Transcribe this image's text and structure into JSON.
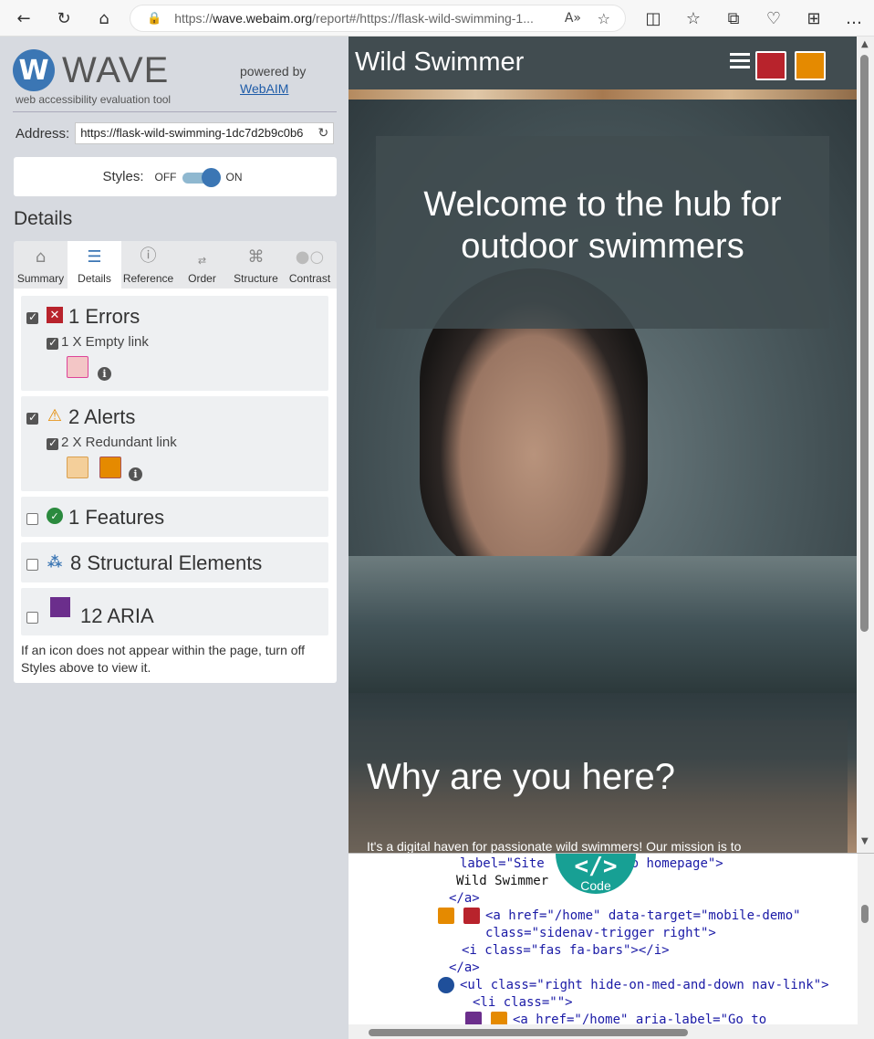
{
  "browser": {
    "url_prefix": "https://",
    "url_host": "wave.webaim.org",
    "url_rest": "/report#/https://flask-wild-swimming-1..."
  },
  "wave": {
    "logo_letter": "W",
    "logo_word": "WAVE",
    "tagline": "web accessibility evaluation tool",
    "powered_by": "powered by",
    "webaim_link": "WebAIM",
    "address_label": "Address:",
    "address_value": "https://flask-wild-swimming-1dc7d2b9c0b6",
    "styles_label": "Styles:",
    "styles_off": "OFF",
    "styles_on": "ON",
    "details_heading": "Details",
    "tabs": [
      {
        "label": "Summary",
        "icon": "home-icon"
      },
      {
        "label": "Details",
        "icon": "list-icon"
      },
      {
        "label": "Reference",
        "icon": "info-icon"
      },
      {
        "label": "Order",
        "icon": "order-icon"
      },
      {
        "label": "Structure",
        "icon": "structure-icon"
      },
      {
        "label": "Contrast",
        "icon": "contrast-icon"
      }
    ],
    "groups": {
      "errors": {
        "title": "1 Errors",
        "item": "1 X Empty link"
      },
      "alerts": {
        "title": "2 Alerts",
        "item": "2 X Redundant link"
      },
      "features": {
        "title": "1 Features"
      },
      "structural": {
        "title": "8 Structural Elements"
      },
      "aria": {
        "title": "12 ARIA"
      }
    },
    "note": "If an icon does not appear within the page, turn off Styles above to view it."
  },
  "site": {
    "title": "Wild Swimmer",
    "welcome": "Welcome to the hub for outdoor swimmers",
    "why": "Why are you here?",
    "mission": "It's a digital haven for passionate wild swimmers! Our mission is to"
  },
  "code": {
    "badge_label": "Code",
    "badge_symbol": "</>",
    "line1": "label=\"Site",
    "line1b": "to homepage\">",
    "line2": "Wild Swimmer",
    "line3": "</a>",
    "line4": "<a href=\"/home\" data-target=\"mobile-demo\"",
    "line5": "class=\"sidenav-trigger right\">",
    "line6": "<i class=\"fas fa-bars\"></i>",
    "line7": "</a>",
    "line8": "<ul class=\"right hide-on-med-and-down nav-link\">",
    "line9": "<li class=\"\">",
    "line10": "<a href=\"/home\" aria-label=\"Go to"
  },
  "colors": {
    "wave_blue": "#3b76b4",
    "error_red": "#b8232c",
    "alert_orange": "#e58a00",
    "feature_green": "#2b8a3e",
    "aria_purple": "#6b2e8c",
    "code_teal": "#17a094"
  }
}
